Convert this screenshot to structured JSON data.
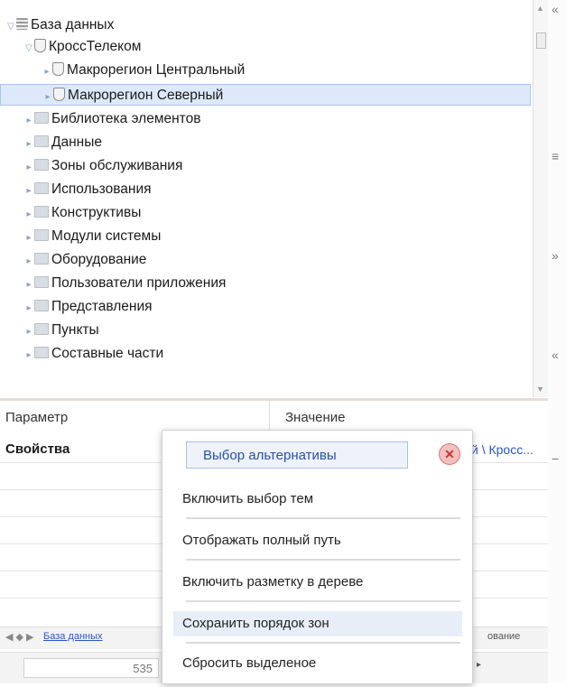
{
  "tree": {
    "items": [
      {
        "label": "База данных",
        "icon": "database-icon",
        "expander": "expanded",
        "level": 0
      },
      {
        "label": "КроссТелеком",
        "icon": "shield-icon",
        "expander": "expanded",
        "level": 1
      },
      {
        "label": "Макрорегион Центральный",
        "icon": "shield-icon",
        "expander": "collapsed",
        "level": 2
      },
      {
        "label": "Макрорегион Северный",
        "icon": "shield-icon",
        "expander": "collapsed",
        "level": 2,
        "selected": true
      },
      {
        "label": "Библиотека элементов",
        "icon": "folder-icon",
        "expander": "collapsed",
        "level": 1
      },
      {
        "label": "Данные",
        "icon": "folder-icon",
        "expander": "collapsed",
        "level": 1
      },
      {
        "label": "Зоны обслуживания",
        "icon": "folder-icon",
        "expander": "collapsed",
        "level": 1
      },
      {
        "label": "Использования",
        "icon": "folder-icon",
        "expander": "collapsed",
        "level": 1
      },
      {
        "label": "Конструктивы",
        "icon": "folder-icon",
        "expander": "collapsed",
        "level": 1
      },
      {
        "label": "Модули системы",
        "icon": "folder-icon",
        "expander": "collapsed",
        "level": 1
      },
      {
        "label": "Оборудование",
        "icon": "folder-icon",
        "expander": "collapsed",
        "level": 1
      },
      {
        "label": "Пользователи приложения",
        "icon": "folder-icon",
        "expander": "collapsed",
        "level": 1
      },
      {
        "label": "Представления",
        "icon": "folder-icon",
        "expander": "collapsed",
        "level": 1
      },
      {
        "label": "Пункты",
        "icon": "folder-icon",
        "expander": "collapsed",
        "level": 1
      },
      {
        "label": "Составные части",
        "icon": "folder-icon",
        "expander": "collapsed",
        "level": 1
      }
    ]
  },
  "properties": {
    "col_param": "Параметр",
    "col_value": "Значение",
    "row1_param": "Свойства",
    "row1_value": "й \\ Кросс..."
  },
  "bottom_tabs": {
    "nav": "◀ ◆ ▶",
    "tab1": "База данных",
    "tab2": "ование"
  },
  "status": {
    "number": "535"
  },
  "context_menu": {
    "header": "Выбор альтернативы",
    "items": [
      {
        "label": "Включить выбор тем"
      },
      {
        "label": "Отображать полный путь"
      },
      {
        "label": "Включить разметку в дереве"
      },
      {
        "label": "Сохранить порядок зон",
        "highlighted": true
      },
      {
        "label": "Сбросить выделеное"
      }
    ]
  },
  "colors": {
    "selection": "#dde9fb",
    "link": "#2a57c4",
    "menu_header": "#2a4fa8"
  }
}
